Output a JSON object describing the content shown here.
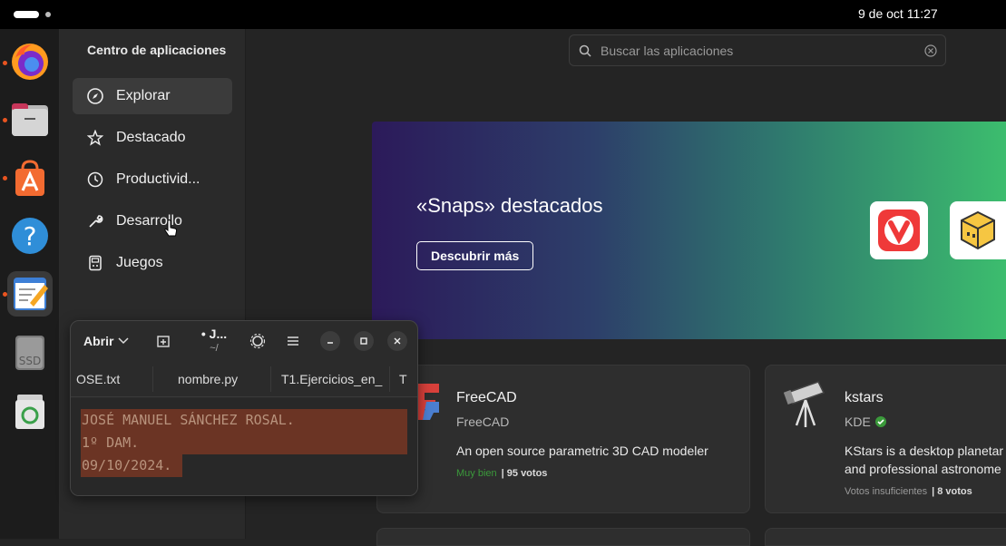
{
  "topbar": {
    "clock": "9 de oct  11:27"
  },
  "dock": {
    "items": [
      {
        "name": "firefox-icon",
        "running": true
      },
      {
        "name": "files-icon",
        "running": true
      },
      {
        "name": "app-center-icon",
        "running": true
      },
      {
        "name": "help-icon",
        "running": false
      },
      {
        "name": "text-editor-icon",
        "running": true,
        "active": true
      },
      {
        "name": "ssd-drive-icon",
        "label": "SSD",
        "running": false
      },
      {
        "name": "trash-icon",
        "running": false
      }
    ]
  },
  "sidebar": {
    "title": "Centro de aplicaciones",
    "items": [
      {
        "label": "Explorar",
        "icon": "compass-icon",
        "selected": true
      },
      {
        "label": "Destacado",
        "icon": "star-icon"
      },
      {
        "label": "Productivid...",
        "icon": "clock-icon"
      },
      {
        "label": "Desarrollo",
        "icon": "wrench-icon"
      },
      {
        "label": "Juegos",
        "icon": "gamepad-icon"
      }
    ]
  },
  "search": {
    "placeholder": "Buscar las aplicaciones"
  },
  "banner": {
    "title": "«Snaps» destacados",
    "button_label": "Descubrir más",
    "apps": [
      "vivaldi-icon",
      "cube-app-icon"
    ]
  },
  "cards": [
    {
      "name": "FreeCAD",
      "developer": "FreeCAD",
      "verified": false,
      "description": "An open source parametric 3D CAD modeler",
      "rating_label": "Muy bien",
      "votes": "| 95 votos",
      "rating_color": "#3b9a3b"
    },
    {
      "name": "kstars",
      "developer": "KDE",
      "verified": true,
      "description_line1": "KStars is a desktop planetar",
      "description_line2": "and professional astronome",
      "rating_label": "Votos insuficientes",
      "votes": "| 8 votos",
      "rating_color": "#9a9a9a"
    }
  ],
  "editor": {
    "open_label": "Abrir",
    "title": "• J...",
    "subtitle": "~/",
    "tabs": [
      "OSE.txt",
      "nombre.py",
      "T1.Ejercicios_en_",
      "T"
    ],
    "lines": [
      "JOSÉ MANUEL SÁNCHEZ ROSAL.",
      "1º DAM.",
      "09/10/2024."
    ]
  },
  "colors": {
    "accent": "#e95420",
    "selection": "#6b3424",
    "banner_start": "#2c1a5a",
    "banner_end": "#3cbd6e"
  }
}
